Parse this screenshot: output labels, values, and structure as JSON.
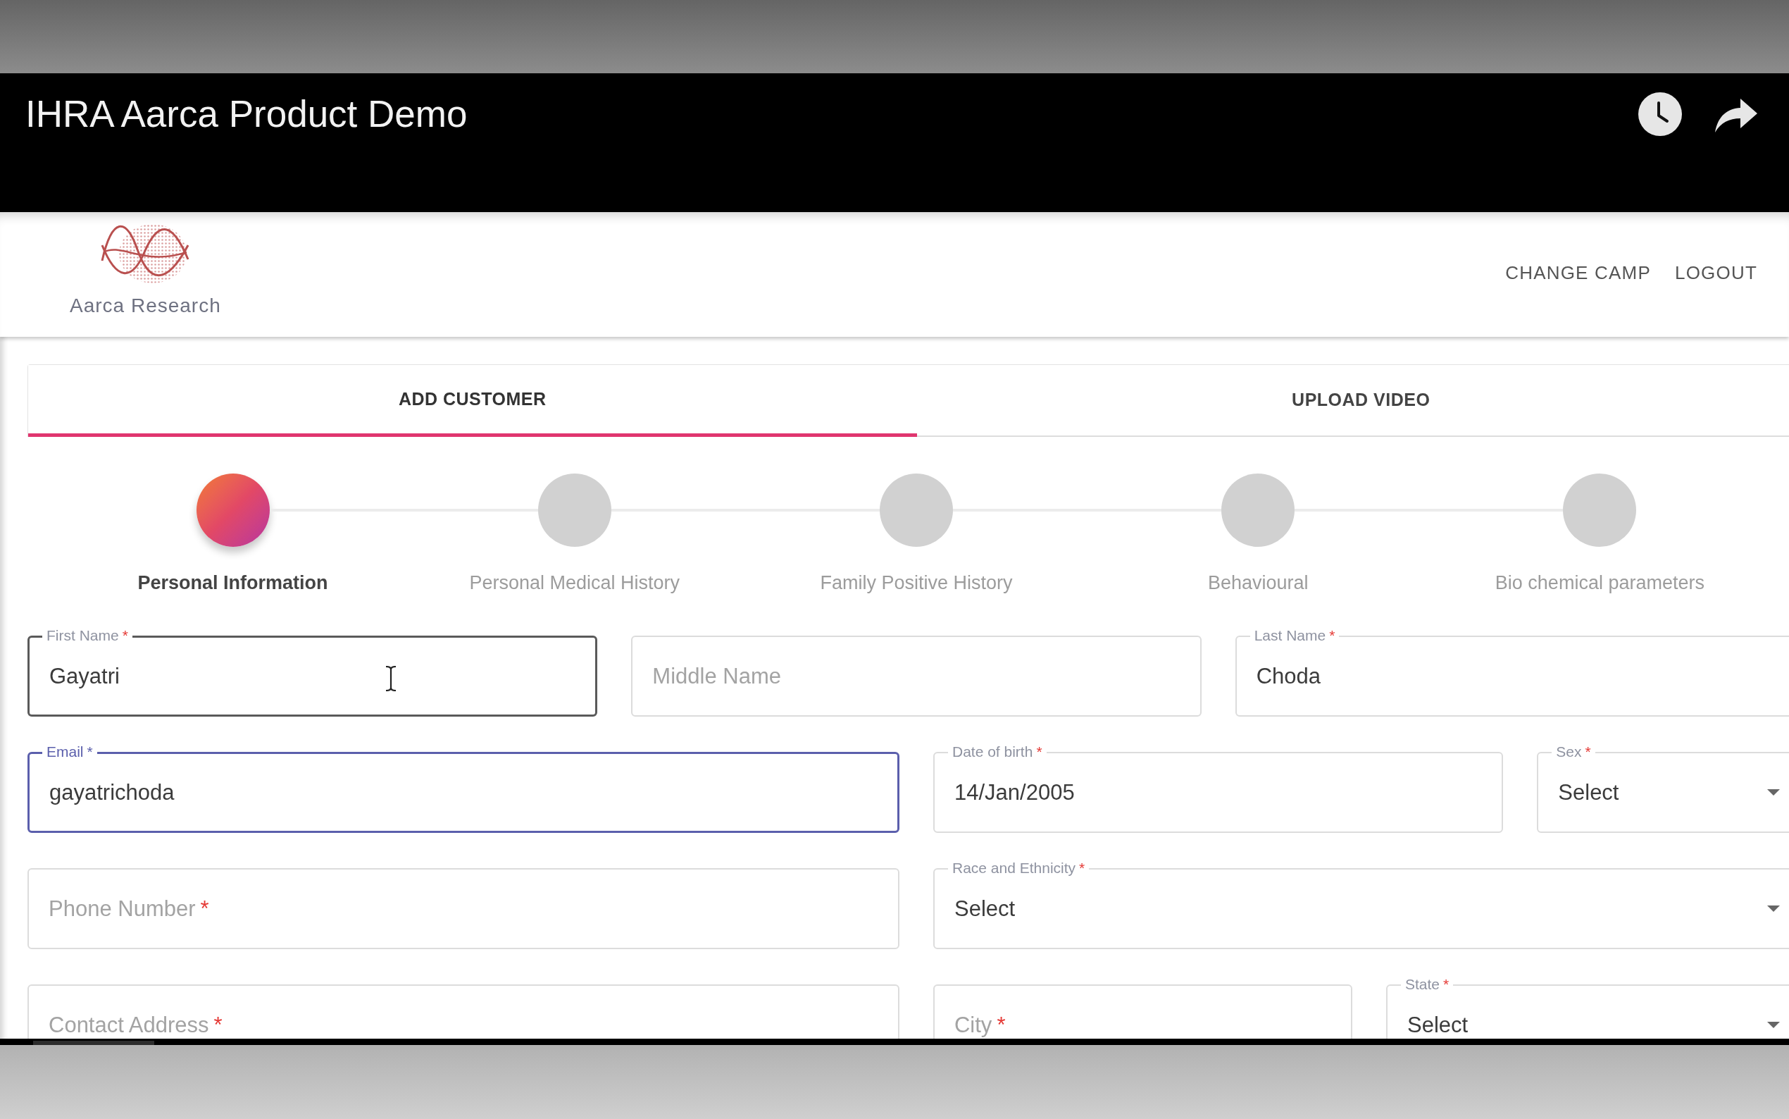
{
  "video": {
    "title": "IHRA Aarca Product Demo"
  },
  "app_header": {
    "logo_text": "Aarca Research",
    "nav": [
      {
        "label": "CHANGE CAMP"
      },
      {
        "label": "LOGOUT"
      }
    ]
  },
  "tabs": [
    {
      "label": "ADD CUSTOMER",
      "selected": true
    },
    {
      "label": "UPLOAD VIDEO",
      "selected": false
    }
  ],
  "steps": [
    {
      "label": "Personal Information",
      "selected": true
    },
    {
      "label": "Personal Medical History",
      "selected": false
    },
    {
      "label": "Family Positive History",
      "selected": false
    },
    {
      "label": "Behavioural",
      "selected": false
    },
    {
      "label": "Bio chemical parameters",
      "selected": false
    }
  ],
  "fields": [
    {
      "kind": "text",
      "label": "First Name",
      "required_mark": "*",
      "value": "Gayatri",
      "focused": false,
      "hovered": true
    },
    {
      "kind": "text",
      "placeholder": "Middle Name",
      "focused": false,
      "hovered": false
    },
    {
      "kind": "text",
      "label": "Last Name",
      "required_mark": "*",
      "value": "Choda",
      "focused": false,
      "hovered": false
    },
    {
      "kind": "text",
      "label": "Email",
      "required_mark": "*",
      "value": "gayatrichoda",
      "focused": true,
      "hovered": false
    },
    {
      "kind": "text",
      "label": "Date of birth",
      "required_mark": "*",
      "value": "14/Jan/2005",
      "focused": false,
      "hovered": false
    },
    {
      "kind": "select",
      "label": "Sex",
      "required_mark": "*",
      "value": "Select",
      "focused": false,
      "hovered": false
    },
    {
      "kind": "text",
      "placeholder": "Phone Number",
      "required_mark": "*",
      "focused": false,
      "hovered": false
    },
    {
      "kind": "select",
      "label": "Race and Ethnicity",
      "required_mark": "*",
      "value": "Select",
      "focused": false,
      "hovered": false
    },
    {
      "kind": "text",
      "placeholder": "Contact Address",
      "required_mark": "*",
      "focused": false,
      "hovered": false
    },
    {
      "kind": "text",
      "placeholder": "City",
      "required_mark": "*",
      "focused": false,
      "hovered": false
    },
    {
      "kind": "select",
      "label": "State",
      "required_mark": "*",
      "value": "Select",
      "focused": false,
      "hovered": false
    }
  ]
}
